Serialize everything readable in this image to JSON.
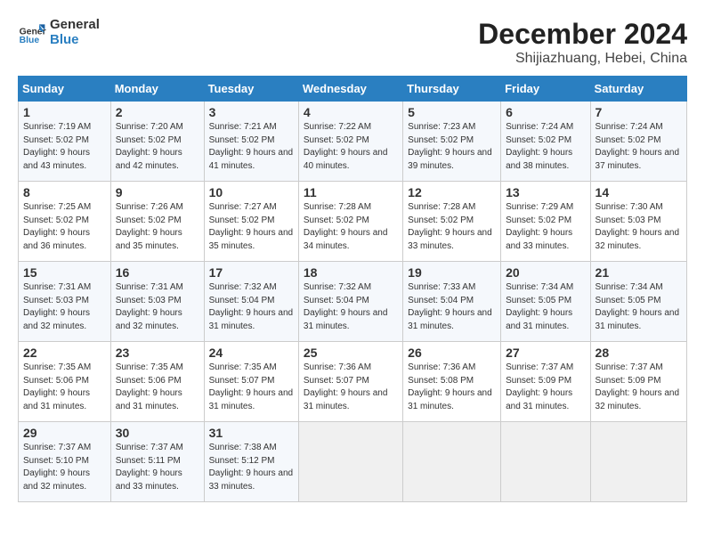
{
  "logo": {
    "line1": "General",
    "line2": "Blue"
  },
  "title": "December 2024",
  "subtitle": "Shijiazhuang, Hebei, China",
  "days_of_week": [
    "Sunday",
    "Monday",
    "Tuesday",
    "Wednesday",
    "Thursday",
    "Friday",
    "Saturday"
  ],
  "weeks": [
    [
      {
        "day": "1",
        "sunrise": "7:19 AM",
        "sunset": "5:02 PM",
        "daylight": "9 hours and 43 minutes."
      },
      {
        "day": "2",
        "sunrise": "7:20 AM",
        "sunset": "5:02 PM",
        "daylight": "9 hours and 42 minutes."
      },
      {
        "day": "3",
        "sunrise": "7:21 AM",
        "sunset": "5:02 PM",
        "daylight": "9 hours and 41 minutes."
      },
      {
        "day": "4",
        "sunrise": "7:22 AM",
        "sunset": "5:02 PM",
        "daylight": "9 hours and 40 minutes."
      },
      {
        "day": "5",
        "sunrise": "7:23 AM",
        "sunset": "5:02 PM",
        "daylight": "9 hours and 39 minutes."
      },
      {
        "day": "6",
        "sunrise": "7:24 AM",
        "sunset": "5:02 PM",
        "daylight": "9 hours and 38 minutes."
      },
      {
        "day": "7",
        "sunrise": "7:24 AM",
        "sunset": "5:02 PM",
        "daylight": "9 hours and 37 minutes."
      }
    ],
    [
      {
        "day": "8",
        "sunrise": "7:25 AM",
        "sunset": "5:02 PM",
        "daylight": "9 hours and 36 minutes."
      },
      {
        "day": "9",
        "sunrise": "7:26 AM",
        "sunset": "5:02 PM",
        "daylight": "9 hours and 35 minutes."
      },
      {
        "day": "10",
        "sunrise": "7:27 AM",
        "sunset": "5:02 PM",
        "daylight": "9 hours and 35 minutes."
      },
      {
        "day": "11",
        "sunrise": "7:28 AM",
        "sunset": "5:02 PM",
        "daylight": "9 hours and 34 minutes."
      },
      {
        "day": "12",
        "sunrise": "7:28 AM",
        "sunset": "5:02 PM",
        "daylight": "9 hours and 33 minutes."
      },
      {
        "day": "13",
        "sunrise": "7:29 AM",
        "sunset": "5:02 PM",
        "daylight": "9 hours and 33 minutes."
      },
      {
        "day": "14",
        "sunrise": "7:30 AM",
        "sunset": "5:03 PM",
        "daylight": "9 hours and 32 minutes."
      }
    ],
    [
      {
        "day": "15",
        "sunrise": "7:31 AM",
        "sunset": "5:03 PM",
        "daylight": "9 hours and 32 minutes."
      },
      {
        "day": "16",
        "sunrise": "7:31 AM",
        "sunset": "5:03 PM",
        "daylight": "9 hours and 32 minutes."
      },
      {
        "day": "17",
        "sunrise": "7:32 AM",
        "sunset": "5:04 PM",
        "daylight": "9 hours and 31 minutes."
      },
      {
        "day": "18",
        "sunrise": "7:32 AM",
        "sunset": "5:04 PM",
        "daylight": "9 hours and 31 minutes."
      },
      {
        "day": "19",
        "sunrise": "7:33 AM",
        "sunset": "5:04 PM",
        "daylight": "9 hours and 31 minutes."
      },
      {
        "day": "20",
        "sunrise": "7:34 AM",
        "sunset": "5:05 PM",
        "daylight": "9 hours and 31 minutes."
      },
      {
        "day": "21",
        "sunrise": "7:34 AM",
        "sunset": "5:05 PM",
        "daylight": "9 hours and 31 minutes."
      }
    ],
    [
      {
        "day": "22",
        "sunrise": "7:35 AM",
        "sunset": "5:06 PM",
        "daylight": "9 hours and 31 minutes."
      },
      {
        "day": "23",
        "sunrise": "7:35 AM",
        "sunset": "5:06 PM",
        "daylight": "9 hours and 31 minutes."
      },
      {
        "day": "24",
        "sunrise": "7:35 AM",
        "sunset": "5:07 PM",
        "daylight": "9 hours and 31 minutes."
      },
      {
        "day": "25",
        "sunrise": "7:36 AM",
        "sunset": "5:07 PM",
        "daylight": "9 hours and 31 minutes."
      },
      {
        "day": "26",
        "sunrise": "7:36 AM",
        "sunset": "5:08 PM",
        "daylight": "9 hours and 31 minutes."
      },
      {
        "day": "27",
        "sunrise": "7:37 AM",
        "sunset": "5:09 PM",
        "daylight": "9 hours and 31 minutes."
      },
      {
        "day": "28",
        "sunrise": "7:37 AM",
        "sunset": "5:09 PM",
        "daylight": "9 hours and 32 minutes."
      }
    ],
    [
      {
        "day": "29",
        "sunrise": "7:37 AM",
        "sunset": "5:10 PM",
        "daylight": "9 hours and 32 minutes."
      },
      {
        "day": "30",
        "sunrise": "7:37 AM",
        "sunset": "5:11 PM",
        "daylight": "9 hours and 33 minutes."
      },
      {
        "day": "31",
        "sunrise": "7:38 AM",
        "sunset": "5:12 PM",
        "daylight": "9 hours and 33 minutes."
      },
      null,
      null,
      null,
      null
    ]
  ]
}
